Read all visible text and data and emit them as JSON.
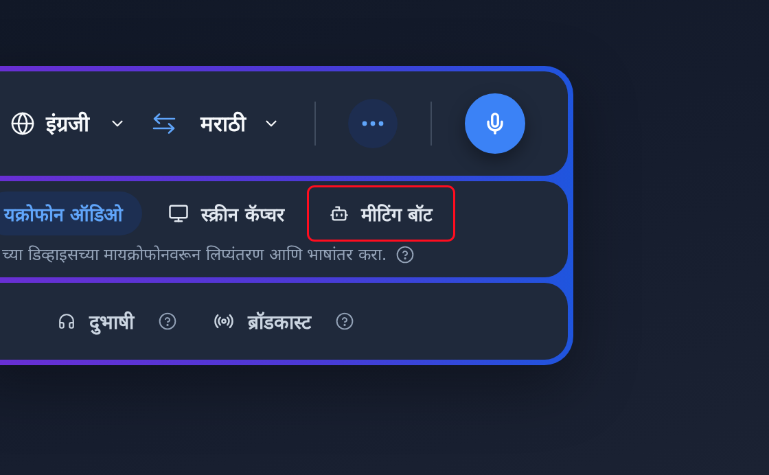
{
  "language_bar": {
    "source_language": "इंग्रजी",
    "target_language": "मराठी"
  },
  "input_source": {
    "tabs": [
      {
        "label": "यक्रोफोन ऑडिओ",
        "kind": "plain",
        "selected": true,
        "highlighted": false
      },
      {
        "label": "स्क्रीन कॅप्चर",
        "kind": "screen",
        "selected": false,
        "highlighted": false
      },
      {
        "label": "मीटिंग बॉट",
        "kind": "bot",
        "selected": false,
        "highlighted": true
      }
    ],
    "description": "च्या डिव्हाइसच्या मायक्रोफोनवरून लिप्यंतरण आणि भाषांतर करा."
  },
  "modes": [
    {
      "label": "दुभाषी",
      "kind": "headphones",
      "selected": false
    },
    {
      "label": "ब्रॉडकास्ट",
      "kind": "broadcast",
      "selected": false
    }
  ]
}
